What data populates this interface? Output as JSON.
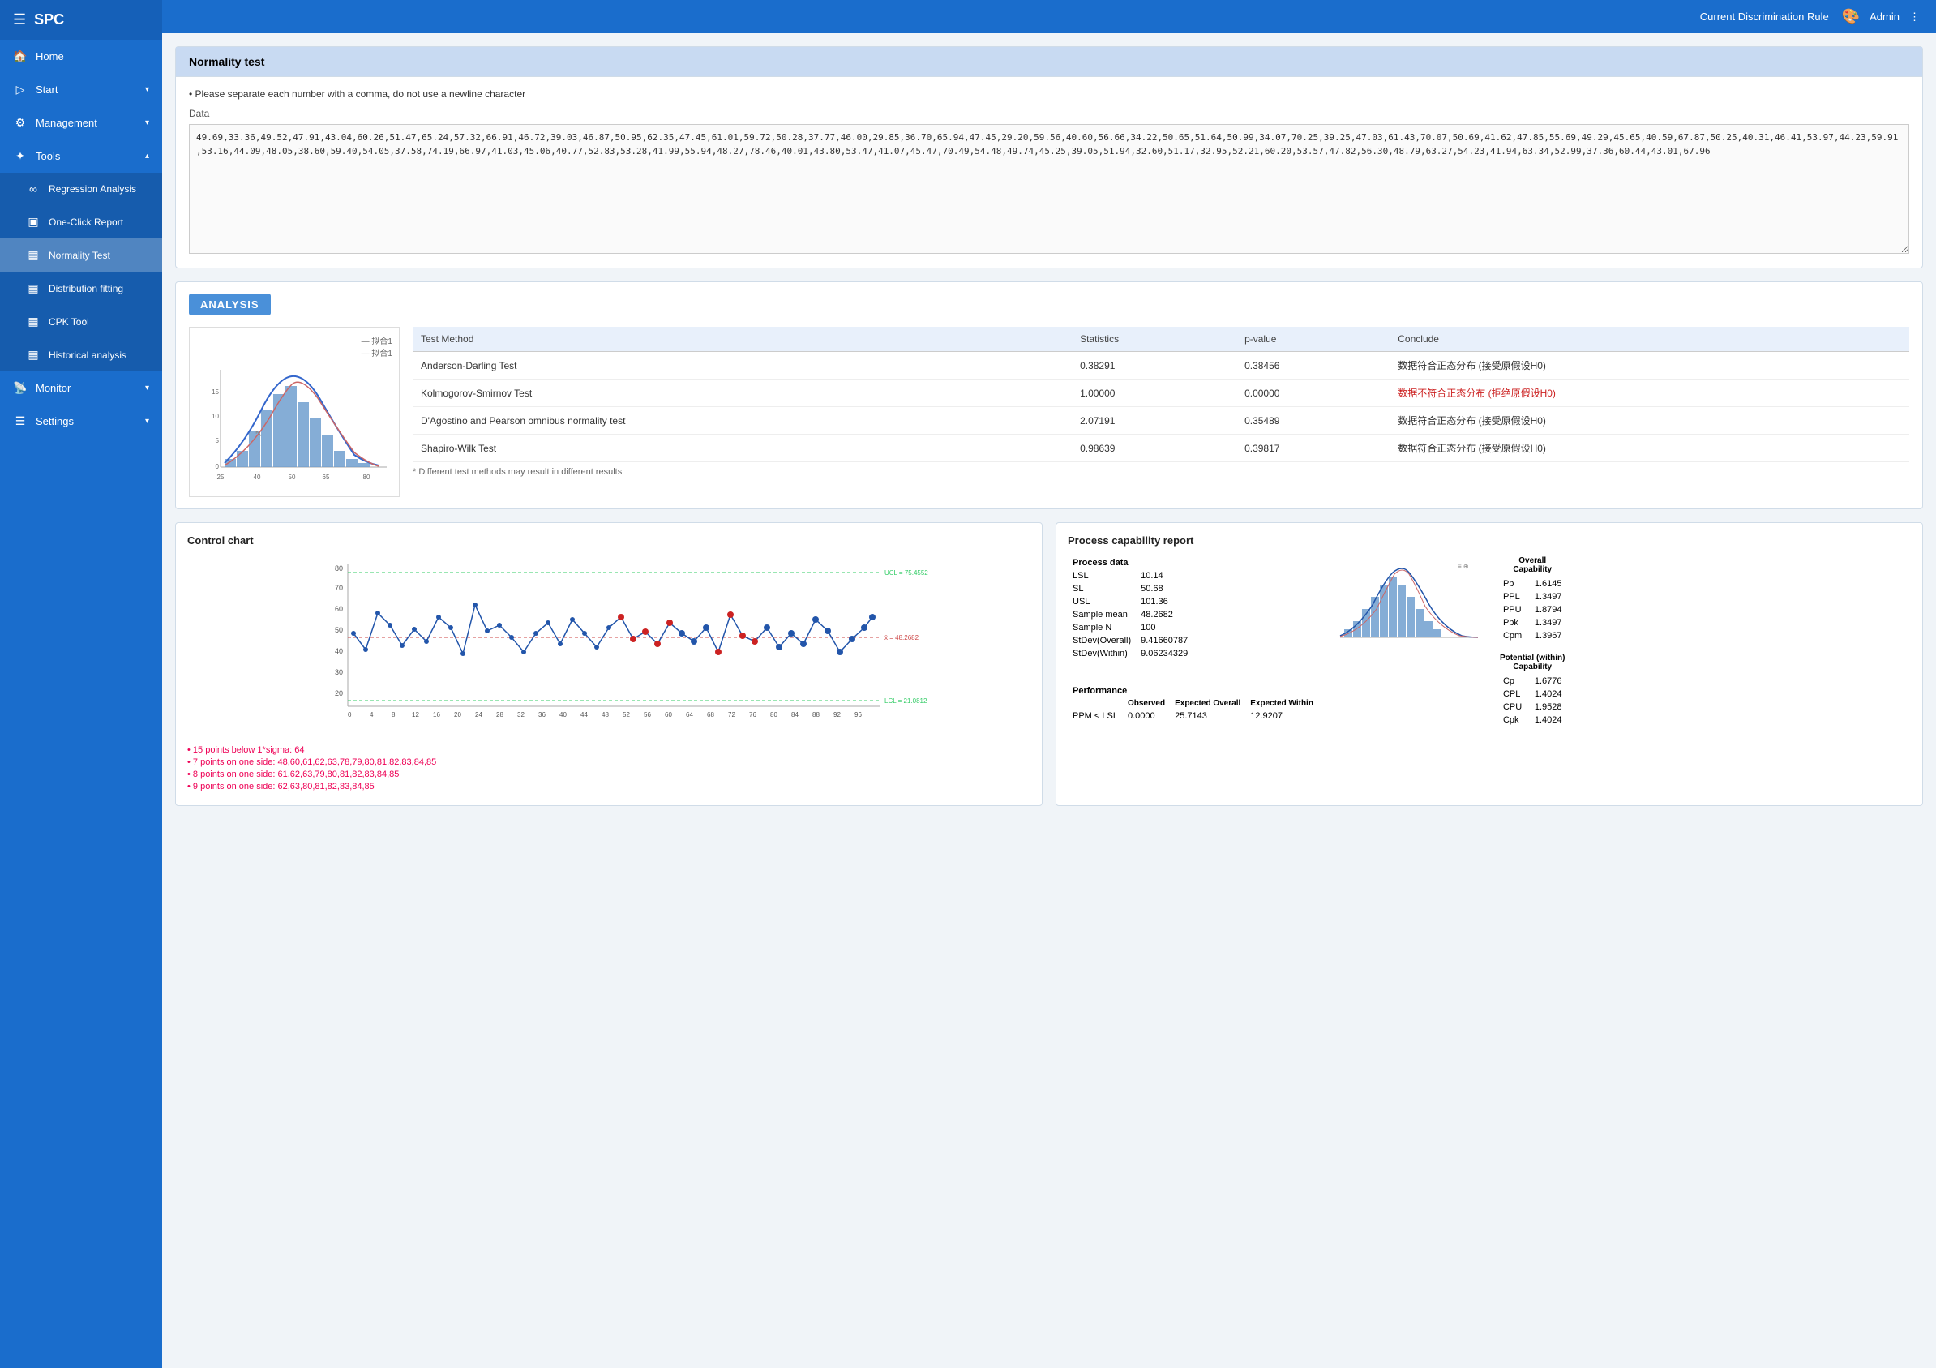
{
  "app": {
    "brand": "SPC",
    "topbar_rule": "Current Discrimination Rule",
    "topbar_admin": "Admin"
  },
  "sidebar": {
    "items": [
      {
        "id": "home",
        "label": "Home",
        "icon": "🏠",
        "expandable": false
      },
      {
        "id": "start",
        "label": "Start",
        "icon": "▶",
        "expandable": true
      },
      {
        "id": "management",
        "label": "Management",
        "icon": "⚙",
        "expandable": true
      },
      {
        "id": "tools",
        "label": "Tools",
        "icon": "✦",
        "expandable": true,
        "expanded": true
      },
      {
        "id": "monitor",
        "label": "Monitor",
        "icon": "📡",
        "expandable": true
      },
      {
        "id": "settings",
        "label": "Settings",
        "icon": "☰",
        "expandable": true
      }
    ],
    "tools_sub": [
      {
        "id": "regression",
        "label": "Regression Analysis",
        "icon": "∞"
      },
      {
        "id": "oneclickreport",
        "label": "One-Click Report",
        "icon": "▣"
      },
      {
        "id": "normality",
        "label": "Normality Test",
        "icon": "▦",
        "active": true
      },
      {
        "id": "distribution",
        "label": "Distribution fitting",
        "icon": "▦"
      },
      {
        "id": "cpk",
        "label": "CPK Tool",
        "icon": "▦"
      },
      {
        "id": "historical",
        "label": "Historical analysis",
        "icon": "▦"
      }
    ]
  },
  "normality_test": {
    "title": "Normality test",
    "hint": "Please separate each number with a comma, do not use a newline character",
    "data_label": "Data",
    "data_value": "49.69,33.36,49.52,47.91,43.04,60.26,51.47,65.24,57.32,66.91,46.72,39.03,46.87,50.95,62.35,47.45,61.01,59.72,50.28,37.77,46.00,29.85,36.70,65.94,47.45,29.20,59.56,40.60,56.66,34.22,50.65,51.64,50.99,34.07,70.25,39.25,47.03,61.43,70.07,50.69,41.62,47.85,55.69,49.29,45.65,40.59,67.87,50.25,40.31,46.41,53.97,44.23,59.91,53.16,44.09,48.05,38.60,59.40,54.05,37.58,74.19,66.97,41.03,45.06,40.77,52.83,53.28,41.99,55.94,48.27,78.46,40.01,43.80,53.47,41.07,45.47,70.49,54.48,49.74,45.25,39.05,51.94,32.60,51.17,32.95,52.21,60.20,53.57,47.82,56.30,48.79,63.27,54.23,41.94,63.34,52.99,37.36,60.44,43.01,67.96"
  },
  "analysis": {
    "section_label": "ANALYSIS",
    "table_headers": [
      "Test Method",
      "Statistics",
      "p-value",
      "Conclude"
    ],
    "rows": [
      {
        "method": "Anderson-Darling Test",
        "statistics": "0.38291",
        "pvalue": "0.38456",
        "conclude": "数据符合正态分布 (接受原假设H0)"
      },
      {
        "method": "Kolmogorov-Smirnov Test",
        "statistics": "1.00000",
        "pvalue": "0.00000",
        "conclude": "数据不符合正态分布 (拒绝原假设H0)"
      },
      {
        "method": "D'Agostino and Pearson omnibus normality test",
        "statistics": "2.07191",
        "pvalue": "0.35489",
        "conclude": "数据符合正态分布 (接受原假设H0)"
      },
      {
        "method": "Shapiro-Wilk Test",
        "statistics": "0.98639",
        "pvalue": "0.39817",
        "conclude": "数据符合正态分布 (接受原假设H0)"
      }
    ],
    "note": "* Different test methods may result in different results"
  },
  "control_chart": {
    "title": "Control chart",
    "ucl_label": "UCL = 75.4552",
    "mean_label": "x̄ = 48.2682",
    "lcl_label": "LCL = 21.0812",
    "ucl_value": 75.4552,
    "mean_value": 48.2682,
    "lcl_value": 21.0812,
    "y_ticks": [
      "80",
      "70",
      "60",
      "50",
      "40",
      "30",
      "20"
    ],
    "x_ticks": [
      "0",
      "4",
      "8",
      "12",
      "16",
      "20",
      "24",
      "28",
      "32",
      "36",
      "40",
      "44",
      "48",
      "52",
      "56",
      "60",
      "64",
      "68",
      "72",
      "76",
      "80",
      "84",
      "88",
      "92",
      "96"
    ],
    "alerts": [
      "15 points below 1*sigma: 64",
      "7 points on one side: 48,60,61,62,63,78,79,80,81,82,83,84,85",
      "8 points on one side: 61,62,63,79,80,81,82,83,84,85",
      "9 points on one side: 62,63,80,81,82,83,84,85"
    ]
  },
  "process_capability": {
    "title": "Process capability report",
    "process_data_label": "Process data",
    "rows": [
      {
        "label": "LSL",
        "value": "10.14"
      },
      {
        "label": "SL",
        "value": "50.68"
      },
      {
        "label": "USL",
        "value": "101.36"
      },
      {
        "label": "Sample mean",
        "value": "48.2682"
      },
      {
        "label": "Sample N",
        "value": "100"
      },
      {
        "label": "StDev(Overall)",
        "value": "9.41660787"
      },
      {
        "label": "StDev(Within)",
        "value": "9.06234329"
      }
    ],
    "overall_label": "Overall Capability",
    "overall": [
      {
        "label": "Pp",
        "value": "1.6145"
      },
      {
        "label": "PPL",
        "value": "1.3497"
      },
      {
        "label": "PPU",
        "value": "1.8794"
      },
      {
        "label": "Ppk",
        "value": "1.3497"
      },
      {
        "label": "Cpm",
        "value": "1.3967"
      }
    ],
    "potential_label": "Potential (within) Capability",
    "potential": [
      {
        "label": "Cp",
        "value": "1.6776"
      },
      {
        "label": "CPL",
        "value": "1.4024"
      },
      {
        "label": "CPU",
        "value": "1.9528"
      },
      {
        "label": "Cpk",
        "value": "1.4024"
      }
    ],
    "performance_label": "Performance",
    "perf_headers": [
      "Observed",
      "Expected Overall",
      "Expected Within"
    ],
    "perf_row_label": "PPM < LSL",
    "perf_values": [
      "0.0000",
      "25.7143",
      "12.9207"
    ]
  }
}
